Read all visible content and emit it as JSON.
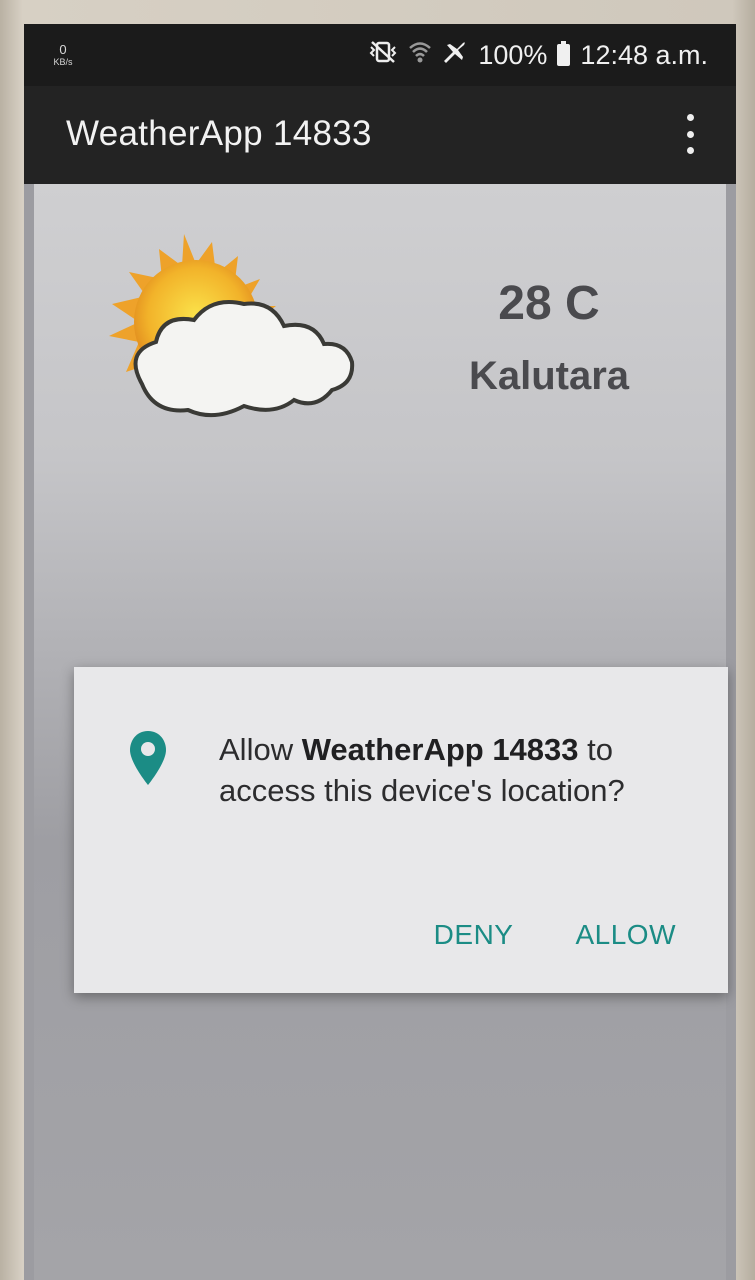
{
  "status_bar": {
    "net_speed_value": "0",
    "net_speed_unit": "KB/s",
    "icons": [
      "mute-vibrate-icon",
      "wifi-icon",
      "airplane-mode-icon",
      "battery-icon"
    ],
    "battery": "100%",
    "time": "12:48 a.m."
  },
  "app_bar": {
    "title": "WeatherApp 14833",
    "menu_icon": "overflow-menu-icon"
  },
  "weather": {
    "icon": "partly-cloudy-icon",
    "temperature": "28 C",
    "city": "Kalutara"
  },
  "permission_dialog": {
    "icon": "location-pin-icon",
    "text_prefix": "Allow ",
    "app_name": "WeatherApp 14833",
    "text_suffix": " to access this device's location?",
    "deny_label": "DENY",
    "allow_label": "ALLOW",
    "accent_color": "#1b8c85"
  }
}
